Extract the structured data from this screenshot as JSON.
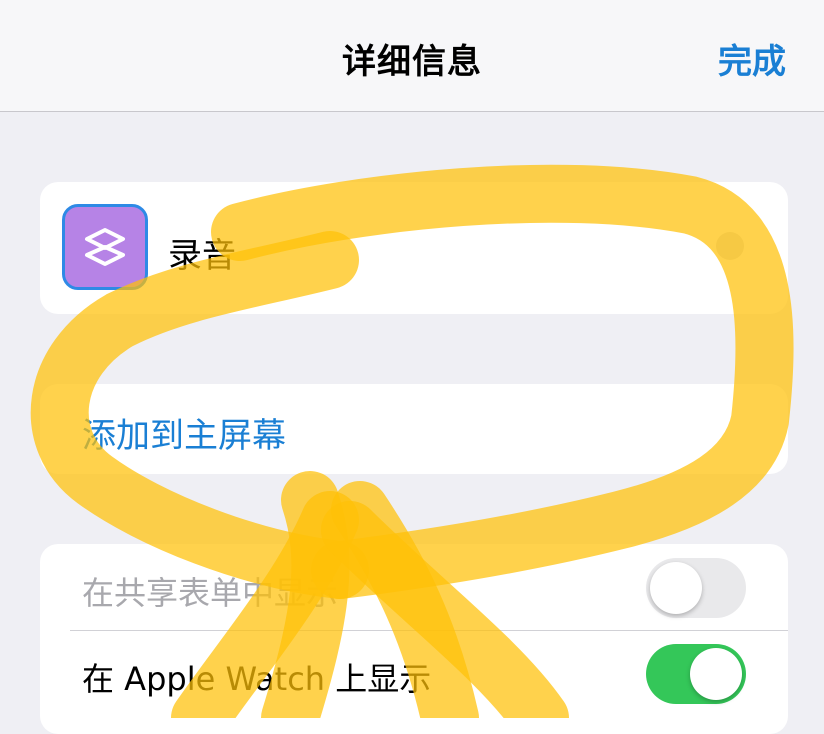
{
  "nav": {
    "title": "详细信息",
    "done_label": "完成"
  },
  "shortcut": {
    "name": "录音",
    "icon": "shortcuts-layers-icon",
    "icon_color": "#b683e6"
  },
  "add_to_home": {
    "label": "添加到主屏幕"
  },
  "settings": [
    {
      "label": "在共享表单中显示",
      "enabled": false
    },
    {
      "label": "在 Apple Watch 上显示",
      "enabled": true
    }
  ],
  "colors": {
    "accent": "#1a7fd4",
    "toggle_on": "#34c759",
    "toggle_off": "#e9e9eb",
    "highlighter": "#ffc107"
  }
}
